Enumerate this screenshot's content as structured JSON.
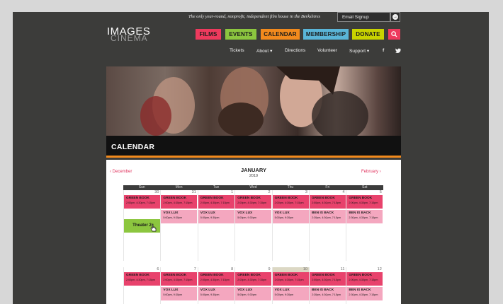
{
  "header": {
    "tagline": "The only year-round, nonprofit, independent film house in the Berkshires",
    "email_signup": "Email Signup",
    "logo_top": "IMAGES",
    "logo_bottom": "CINEMA"
  },
  "nav": [
    {
      "label": "FILMS",
      "color": "#ee3a5d"
    },
    {
      "label": "EVENTS",
      "color": "#8cc63f"
    },
    {
      "label": "CALENDAR",
      "color": "#f28a1d"
    },
    {
      "label": "MEMBERSHIP",
      "color": "#5ab5d8"
    },
    {
      "label": "DONATE",
      "color": "#c8d200"
    }
  ],
  "subnav": [
    {
      "label": "Tickets"
    },
    {
      "label": "About ▾"
    },
    {
      "label": "Directions"
    },
    {
      "label": "Volunteer"
    },
    {
      "label": "Support ▾"
    }
  ],
  "social": {
    "facebook": "f",
    "twitter": "twitter-icon"
  },
  "page_title": "CALENDAR",
  "calendar": {
    "prev": "‹ December",
    "next": "February ›",
    "month": "JANUARY",
    "year": "2019",
    "days": [
      "Sun",
      "Mon",
      "Tue",
      "Wed",
      "Thu",
      "Fri",
      "Sat"
    ],
    "week1": {
      "dates": [
        "30",
        "31",
        "1",
        "2",
        "3",
        "4",
        "5"
      ],
      "row1": [
        {
          "title": "GREEN BOOK",
          "times": "2:00pm, 4:30pm, 7:15pm"
        },
        {
          "title": "GREEN BOOK",
          "times": "2:00pm, 4:30pm, 7:15pm"
        },
        {
          "title": "GREEN BOOK",
          "times": "2:00pm, 4:30pm, 7:15pm"
        },
        {
          "title": "GREEN BOOK",
          "times": "2:00pm, 4:30pm, 7:15pm"
        },
        {
          "title": "GREEN BOOK",
          "times": "2:00pm, 4:30pm, 7:15pm"
        },
        {
          "title": "GREEN BOOK",
          "times": "2:00pm, 4:30pm, 7:15pm"
        },
        {
          "title": "GREEN BOOK",
          "times": "2:00pm, 4:30pm, 7:15pm"
        }
      ],
      "row2": [
        {
          "title": "VOX LUX",
          "times": "5:00pm, 9:30pm"
        },
        {
          "title": "VOX LUX",
          "times": "5:00pm, 9:30pm"
        },
        {
          "title": "VOX LUX",
          "times": "5:00pm, 9:30pm"
        },
        {
          "title": "VOX LUX",
          "times": "5:00pm, 9:30pm"
        },
        {
          "title": "BEN IS BACK",
          "times": "2:30pm, 4:30pm, 7:15pm"
        },
        {
          "title": "BEN IS BACK",
          "times": "2:30pm, 4:30pm, 7:15pm"
        }
      ],
      "theater_tab": "Theater 2"
    },
    "week2": {
      "dates": [
        "6",
        "7",
        "8",
        "9",
        "10",
        "11",
        "12"
      ],
      "row1": [
        {
          "title": "GREEN BOOK",
          "times": "2:00pm, 4:30pm, 7:15pm"
        },
        {
          "title": "GREEN BOOK",
          "times": "2:00pm, 4:30pm, 7:15pm"
        },
        {
          "title": "GREEN BOOK",
          "times": "2:00pm, 4:30pm, 7:15pm"
        },
        {
          "title": "GREEN BOOK",
          "times": "2:00pm, 4:30pm, 7:15pm"
        },
        {
          "title": "GREEN BOOK",
          "times": "2:00pm, 4:30pm, 7:15pm"
        },
        {
          "title": "GREEN BOOK",
          "times": "2:00pm, 4:30pm, 7:15pm"
        },
        {
          "title": "GREEN BOOK",
          "times": "2:00pm, 4:30pm, 7:15pm"
        }
      ],
      "row2": [
        {
          "title": "VOX LUX",
          "times": "5:00pm, 9:30pm"
        },
        {
          "title": "VOX LUX",
          "times": "5:00pm, 9:30pm"
        },
        {
          "title": "VOX LUX",
          "times": "5:00pm, 9:30pm"
        },
        {
          "title": "VOX LUX",
          "times": "5:00pm, 9:30pm"
        },
        {
          "title": "BEN IS BACK",
          "times": "2:30pm, 4:30pm, 7:15pm"
        },
        {
          "title": "BEN IS BACK",
          "times": "2:30pm, 4:30pm, 7:15pm"
        },
        {
          "title": "BEN IS BACK",
          "times": "2:30pm, 4:30pm, 7:15pm"
        }
      ]
    }
  }
}
